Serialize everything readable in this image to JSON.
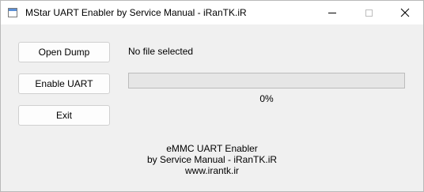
{
  "window": {
    "title": "MStar UART Enabler by Service Manual - iRanTK.iR"
  },
  "buttons": {
    "open_dump": "Open Dump",
    "enable_uart": "Enable UART",
    "exit": "Exit"
  },
  "file": {
    "status": "No file selected"
  },
  "progress": {
    "value_percent": 0,
    "label": "0%"
  },
  "footer": {
    "line1": "eMMC UART Enabler",
    "line2": "by Service Manual - iRanTK.iR",
    "line3": "www.irantk.ir"
  }
}
